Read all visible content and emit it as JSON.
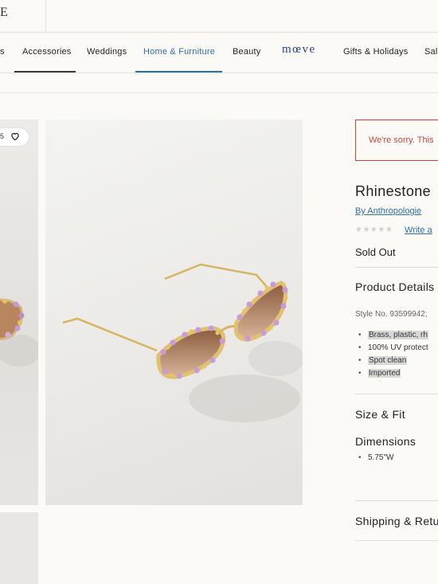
{
  "header": {
    "logo_fragment": "E"
  },
  "nav": {
    "items": [
      {
        "label": "s",
        "active": false
      },
      {
        "label": "Accessories",
        "active": false
      },
      {
        "label": "Weddings",
        "active": false
      },
      {
        "label": "Home & Furniture",
        "active": true
      },
      {
        "label": "Beauty",
        "active": false
      },
      {
        "label": "Gifts & Holidays",
        "active": false
      },
      {
        "label": "Sale",
        "active": false
      }
    ],
    "brand_logo_text": "mœve"
  },
  "gallery": {
    "like_count": "5"
  },
  "product": {
    "error_message": "We're sorry. This",
    "title": "Rhinestone",
    "brand_link": "By Anthropologie",
    "stars": "★★★★★",
    "write_review": "Write a",
    "status": "Sold Out",
    "details_heading": "Product Details",
    "style_no": "Style No. 93599942;",
    "details": [
      "Brass, plastic, rh",
      "100% UV protect",
      "Spot clean",
      "Imported"
    ],
    "size_fit_heading": "Size & Fit",
    "dimensions_heading": "Dimensions",
    "dimensions": [
      "5.75\"W"
    ],
    "shipping_heading": "Shipping & Retu"
  },
  "colors": {
    "accent": "#2d6fa8",
    "error": "#c9453d",
    "brand": "#2b3e8c"
  }
}
